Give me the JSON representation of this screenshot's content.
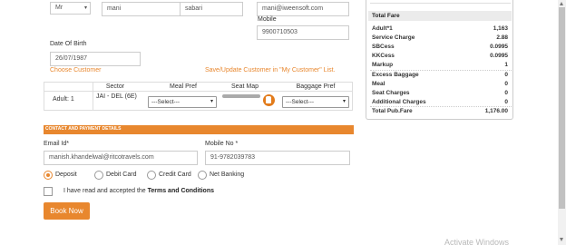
{
  "customer": {
    "title": "Mr",
    "first_name": "mani",
    "last_name": "sabari",
    "email": "mani@iweensoft.com",
    "mobile_label": "Mobile",
    "mobile": "9900710503",
    "dob_label": "Date Of Birth",
    "dob": "26/07/1987",
    "choose_customer": "Choose Customer",
    "save_update": "Save/Update Customer in \"My Customer\" List."
  },
  "pref_table": {
    "headers": [
      "Sector",
      "Meal Pref",
      "Seat Map",
      "Baggage Pref"
    ],
    "row": {
      "passenger": "Adult: 1",
      "sector": "JAI - DEL (6E)",
      "meal": "---Select---",
      "baggage": "---Select---"
    }
  },
  "contact": {
    "section_title": "CONTACT AND PAYMENT DETAILS",
    "email_label": "Email Id*",
    "email": "manish.khandelwal@ritcotravels.com",
    "mobile_label": "Mobile No *",
    "mobile": "91-9782039783"
  },
  "payment": {
    "options": [
      "Deposit",
      "Debit Card",
      "Credit Card",
      "Net Banking"
    ],
    "selected": "Deposit"
  },
  "terms": {
    "prefix": "I have read and accepted the ",
    "link": "Terms and Conditions"
  },
  "book_now": "Book Now",
  "fare": {
    "title": "Total Fare",
    "rows": [
      {
        "label": "Adult*1",
        "value": "1,163"
      },
      {
        "label": "Service Charge",
        "value": "2.88"
      },
      {
        "label": "SBCess",
        "value": "0.0995"
      },
      {
        "label": "KKCess",
        "value": "0.0995"
      },
      {
        "label": "Markup",
        "value": "1"
      },
      {
        "label": "Excess Baggage",
        "value": "0"
      },
      {
        "label": "Meal",
        "value": "0"
      },
      {
        "label": "Seat Charges",
        "value": "0"
      },
      {
        "label": "Additional Charges",
        "value": "0"
      }
    ],
    "total_label": "Total Pub.Fare",
    "total_value": "1,176.00"
  },
  "watermark": "Activate Windows",
  "colors": {
    "accent": "#e8872e",
    "panel_bg": "#ebebeb"
  }
}
